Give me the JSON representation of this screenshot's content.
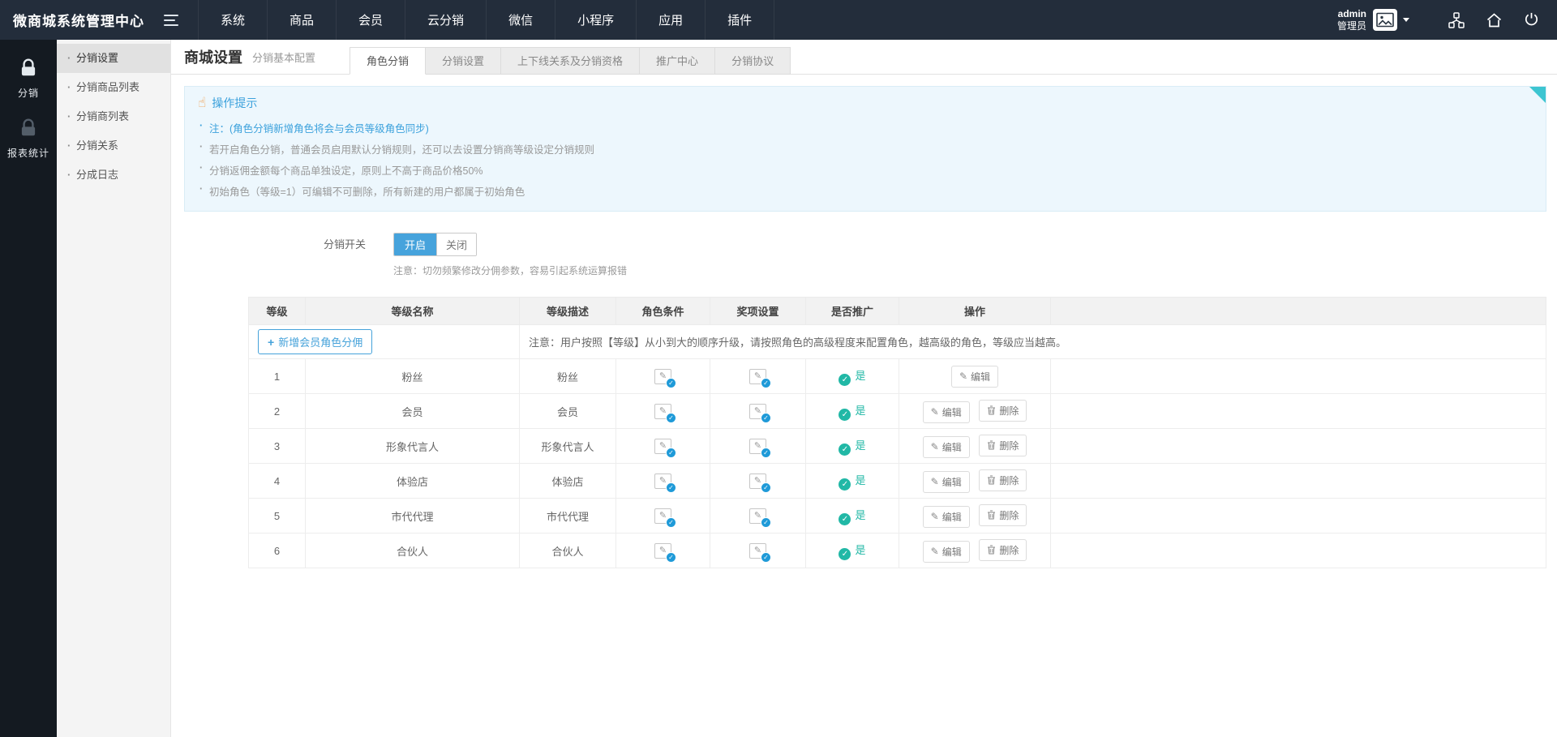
{
  "topbar": {
    "logo": "微商城系统管理中心",
    "nav": [
      "系统",
      "商品",
      "会员",
      "云分销",
      "微信",
      "小程序",
      "应用",
      "插件"
    ],
    "user": {
      "name": "admin",
      "role": "管理员"
    }
  },
  "rail": {
    "items": [
      {
        "label": "分销",
        "icon": "lock-icon",
        "active": true
      },
      {
        "label": "报表统计",
        "icon": "lock-icon",
        "active": false
      }
    ]
  },
  "sidebar": {
    "items": [
      "分销设置",
      "分销商品列表",
      "分销商列表",
      "分销关系",
      "分成日志"
    ],
    "active_index": 0
  },
  "page": {
    "title": "商城设置",
    "subtitle": "分销基本配置",
    "tabs": [
      "角色分销",
      "分销设置",
      "上下线关系及分销资格",
      "推广中心",
      "分销协议"
    ],
    "active_tab": 0
  },
  "tips": {
    "title": "操作提示",
    "lines": [
      {
        "text": "注：(角色分销新增角色将会与会员等级角色同步)",
        "highlight": true
      },
      {
        "text": "若开启角色分销，普通会员启用默认分销规则，还可以去设置分销商等级设定分销规则",
        "highlight": false
      },
      {
        "text": "分销返佣金额每个商品单独设定，原则上不高于商品价格50%",
        "highlight": false
      },
      {
        "text": "初始角色（等级=1）可编辑不可删除，所有新建的用户都属于初始角色",
        "highlight": false
      }
    ]
  },
  "switch": {
    "label": "分销开关",
    "on": "开启",
    "off": "关闭",
    "state": "开启",
    "note": "注意：切勿频繁修改分佣参数，容易引起系统运算报错"
  },
  "table": {
    "headers": [
      "等级",
      "等级名称",
      "等级描述",
      "角色条件",
      "奖项设置",
      "是否推广",
      "操作"
    ],
    "add_button": "新增会员角色分佣",
    "notice": "注意：用户按照【等级】从小到大的顺序升级，请按照角色的高级程度来配置角色，越高级的角色，等级应当越高。",
    "edit_label": "编辑",
    "delete_label": "删除",
    "rows": [
      {
        "level": "1",
        "name": "粉丝",
        "desc": "粉丝",
        "promote": "是"
      },
      {
        "level": "2",
        "name": "会员",
        "desc": "会员",
        "promote": "是"
      },
      {
        "level": "3",
        "name": "形象代言人",
        "desc": "形象代言人",
        "promote": "是"
      },
      {
        "level": "4",
        "name": "体验店",
        "desc": "体验店",
        "promote": "是"
      },
      {
        "level": "5",
        "name": "市代代理",
        "desc": "市代代理",
        "promote": "是"
      },
      {
        "level": "6",
        "name": "合伙人",
        "desc": "合伙人",
        "promote": "是"
      }
    ]
  },
  "icons": {
    "pencil": "✎",
    "check": "✓",
    "plus": "+",
    "hand": "☝"
  },
  "colors": {
    "topbar_bg": "#232d3b",
    "rail_bg": "#141a21",
    "accent_blue": "#45a2da",
    "tips_bg": "#edf7fd",
    "corner_teal": "#3dc5d1",
    "success_teal": "#21b8a6",
    "badge_blue": "#1f9ad8",
    "danger_red": "#f4503a"
  }
}
